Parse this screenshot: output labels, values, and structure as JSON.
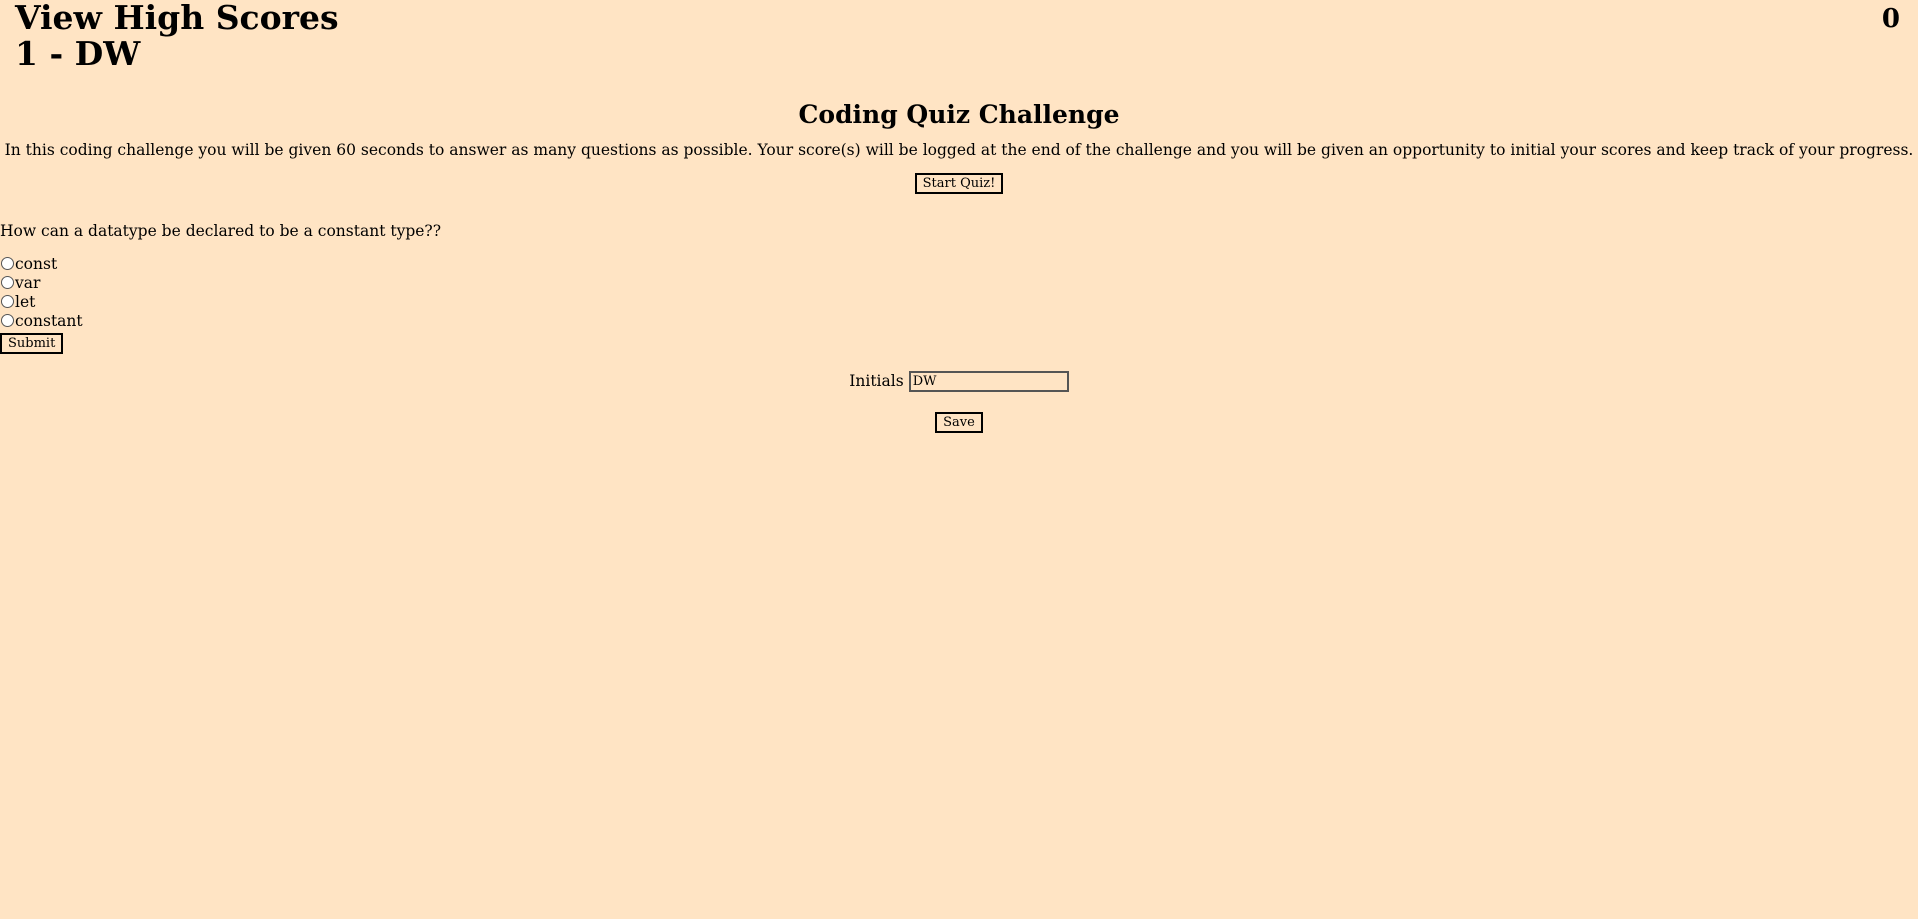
{
  "header": {
    "high_scores_link": "View High Scores",
    "high_score_entry": "1 - DW",
    "timer": "0"
  },
  "intro": {
    "title": "Coding Quiz Challenge",
    "description": "In this coding challenge you will be given 60 seconds to answer as many questions as possible. Your score(s) will be logged at the end of the challenge and you will be given an opportunity to initial your scores and keep track of your progress.",
    "start_button": "Start Quiz!"
  },
  "quiz": {
    "question": "How can a datatype be declared to be a constant type??",
    "choices": [
      "const",
      "var",
      "let",
      "constant"
    ],
    "submit_button": "Submit"
  },
  "save_form": {
    "initials_label": "Initials",
    "initials_value": "DW",
    "save_button": "Save"
  },
  "colors": {
    "background": "#ffe4c4"
  }
}
